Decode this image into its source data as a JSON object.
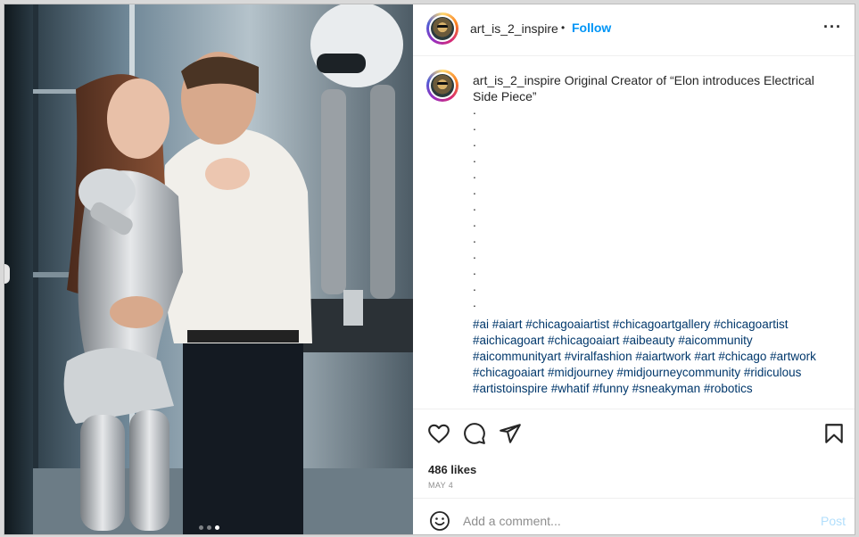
{
  "header": {
    "username": "art_is_2_inspire",
    "separator": "•",
    "follow_label": "Follow",
    "more_icon": "more-options-icon"
  },
  "caption": {
    "username": "art_is_2_inspire",
    "text": "Original Creator of “Elon introduces Electrical Side Piece”",
    "dots": [
      ".",
      ".",
      ".",
      ".",
      ".",
      ".",
      ".",
      ".",
      ".",
      ".",
      ".",
      ".",
      "."
    ],
    "hashtags": "#ai #aiart #chicagoaiartist #chicagoartgallery #chicagoartist #aichicagoart #chicagoaiart #aibeauty #aicommunity #aicommunityart #viralfashion #aiartwork #art #chicago #artwork #chicagoaiart #midjourney #midjourneycommunity #ridiculous #artistoinspire #whatif #funny #sneakyman #robotics"
  },
  "actions": {
    "icons": [
      "heart-icon",
      "comment-icon",
      "share-icon",
      "bookmark-icon"
    ],
    "likes": "486 likes",
    "date": "MAY 4"
  },
  "comment_bar": {
    "placeholder": "Add a comment...",
    "post_label": "Post"
  },
  "carousel": {
    "current_slide": 3,
    "total_slides": 3
  },
  "colors": {
    "link_blue": "#0095f6",
    "hashtag_blue": "#00376b",
    "post_disabled": "#b2dffc"
  }
}
